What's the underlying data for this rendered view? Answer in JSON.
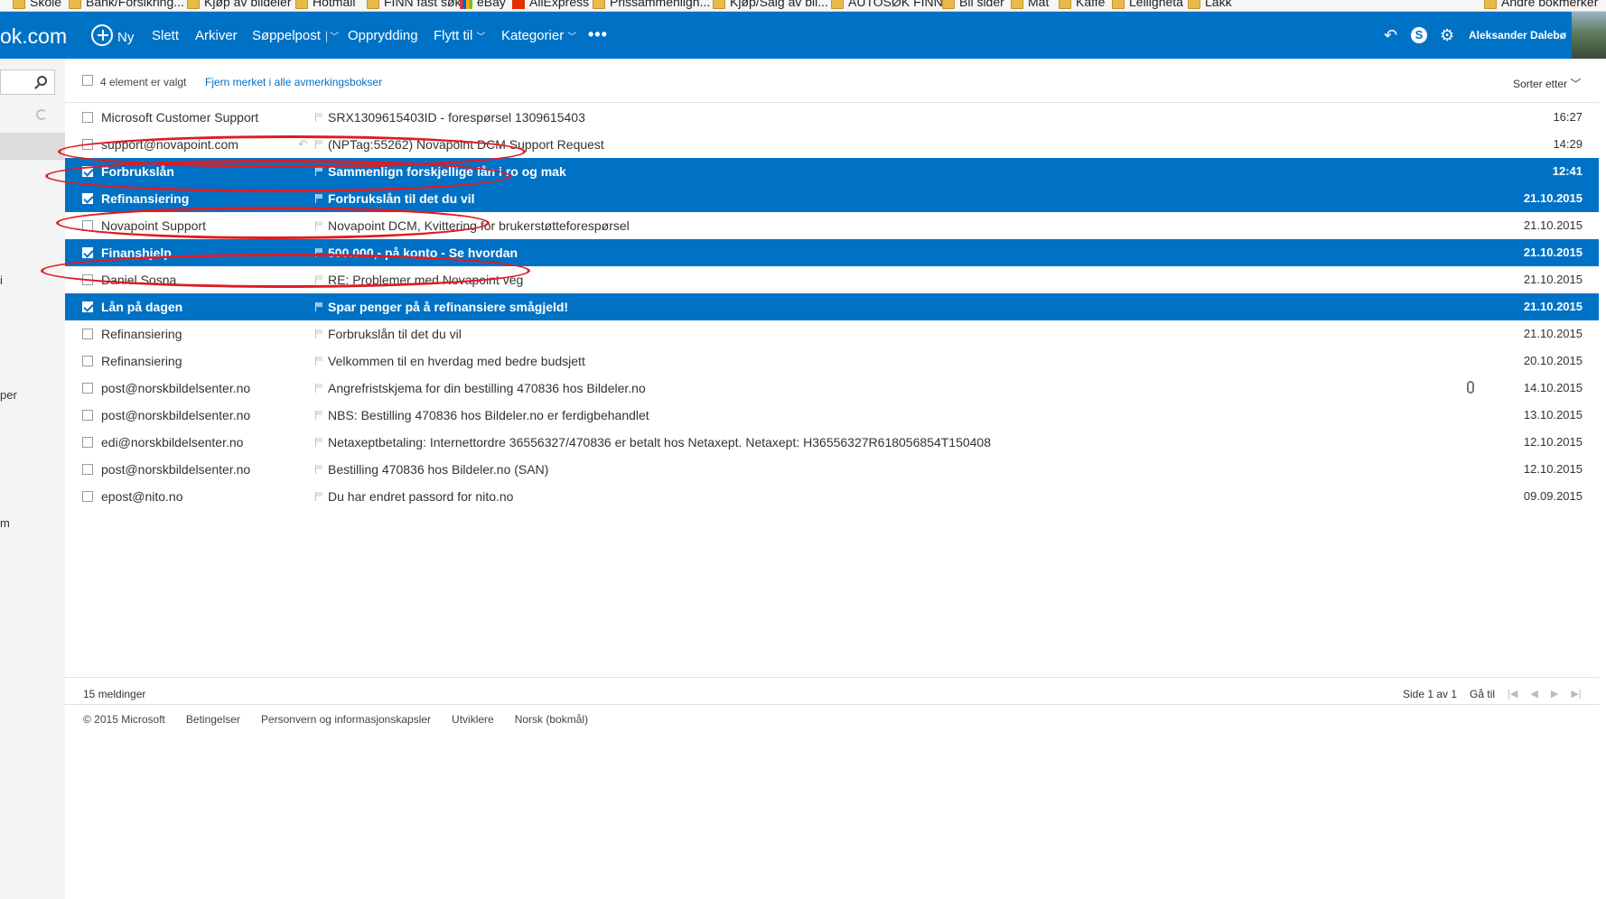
{
  "bookmarks": [
    {
      "label": "Skole",
      "type": "folder"
    },
    {
      "label": "Bank/Forsikring...",
      "type": "folder"
    },
    {
      "label": "Kjøp av bildeler",
      "type": "folder"
    },
    {
      "label": "Hotmail",
      "type": "folder"
    },
    {
      "label": "FINN fast søk",
      "type": "folder"
    },
    {
      "label": "eBay",
      "type": "site"
    },
    {
      "label": "AliExpress",
      "type": "site"
    },
    {
      "label": "Prissammenlign...",
      "type": "folder"
    },
    {
      "label": "Kjøp/Salg av bil...",
      "type": "folder"
    },
    {
      "label": "AUTOSØK FINN",
      "type": "folder"
    },
    {
      "label": "Bil sider",
      "type": "folder"
    },
    {
      "label": "Mat",
      "type": "folder"
    },
    {
      "label": "Kaffe",
      "type": "folder"
    },
    {
      "label": "Leilighetа",
      "type": "folder"
    },
    {
      "label": "Lakk",
      "type": "folder"
    },
    {
      "label": "Andre bokmerker",
      "type": "folder"
    }
  ],
  "topbar": {
    "brand": "ok.com",
    "new_label": "Ny",
    "delete_label": "Slett",
    "archive_label": "Arkiver",
    "junk_label": "Søppelpost",
    "sweep_label": "Opprydding",
    "move_label": "Flytt til",
    "categories_label": "Kategorier",
    "more_label": "•••",
    "user_name": "Aleksander Dalebø",
    "accent": "#0072c6"
  },
  "left": {
    "fragment_1": "i",
    "fragment_2": "per",
    "fragment_3": "m"
  },
  "list_header": {
    "selected_count": "4 element er valgt",
    "clear_link": "Fjern merket i alle avmerkingsbokser",
    "sort_label": "Sorter etter"
  },
  "messages": [
    {
      "from": "Microsoft Customer Support",
      "subject": "SRX1309615403ID - forespørsel 1309615403",
      "date": "16:27",
      "selected": false
    },
    {
      "from": "support@novapoint.com",
      "subject": "(NPTag:55262) Novapoint DCM Support Request",
      "date": "14:29",
      "selected": false,
      "replied": true
    },
    {
      "from": "Forbrukslån",
      "subject": "Sammenlign forskjellige lån i ro og mak",
      "date": "12:41",
      "selected": true
    },
    {
      "from": "Refinansiering",
      "subject": "Forbrukslån til det du vil",
      "date": "21.10.2015",
      "selected": true
    },
    {
      "from": "Novapoint Support",
      "subject": "Novapoint DCM, Kvittering for brukerstøtteforespørsel",
      "date": "21.10.2015",
      "selected": false
    },
    {
      "from": "Finanshjelp",
      "subject": "500.000,- på konto - Se hvordan",
      "date": "21.10.2015",
      "selected": true
    },
    {
      "from": "Daniel Sosna",
      "subject": "RE: Problemer med Novapoint veg",
      "date": "21.10.2015",
      "selected": false
    },
    {
      "from": "Lån på dagen",
      "subject": "Spar penger på å refinansiere smågjeld!",
      "date": "21.10.2015",
      "selected": true
    },
    {
      "from": "Refinansiering",
      "subject": "Forbrukslån til det du vil",
      "date": "21.10.2015",
      "selected": false
    },
    {
      "from": "Refinansiering",
      "subject": "Velkommen til en hverdag med bedre budsjett",
      "date": "20.10.2015",
      "selected": false
    },
    {
      "from": "post@norskbildelsenter.no",
      "subject": "Angrefristskjema for din bestilling 470836 hos Bildeler.no",
      "date": "14.10.2015",
      "selected": false,
      "attachment": true
    },
    {
      "from": "post@norskbildelsenter.no",
      "subject": "NBS: Bestilling 470836 hos Bildeler.no er ferdigbehandlet",
      "date": "13.10.2015",
      "selected": false
    },
    {
      "from": "edi@norskbildelsenter.no",
      "subject": "Netaxeptbetaling: Internettordre 36556327/470836 er betalt hos Netaxept. Netaxept: H36556327R618056854T150408",
      "date": "12.10.2015",
      "selected": false
    },
    {
      "from": "post@norskbildelsenter.no",
      "subject": "Bestilling 470836 hos Bildeler.no (SAN)",
      "date": "12.10.2015",
      "selected": false
    },
    {
      "from": "epost@nito.no",
      "subject": "Du har endret passord for nito.no",
      "date": "09.09.2015",
      "selected": false
    }
  ],
  "footer": {
    "message_count": "15 meldinger",
    "page_label": "Side 1 av 1",
    "goto_label": "Gå til",
    "copyright": "© 2015 Microsoft",
    "terms": "Betingelser",
    "privacy": "Personvern og informasjonskapsler",
    "developers": "Utviklere",
    "language": "Norsk (bokmål)"
  },
  "annotation_color": "#e01b22"
}
